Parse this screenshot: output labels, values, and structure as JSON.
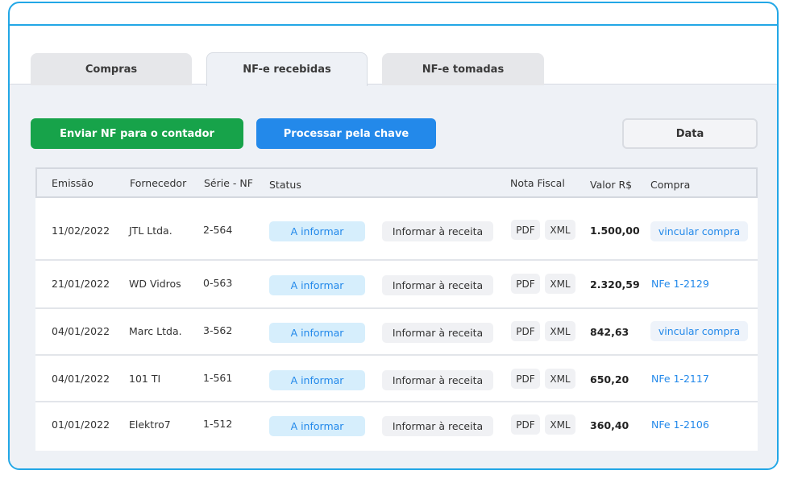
{
  "tabs": [
    "Compras",
    "NF-e recebidas",
    "NF-e tomadas"
  ],
  "active_tab": "NF-e recebidas",
  "actions": {
    "send_label": "Enviar NF para o contador",
    "process_label": "Processar pela chave",
    "date_label": "Data"
  },
  "table": {
    "headers": [
      "Emissão",
      "Fornecedor",
      "Série - NF",
      "Status",
      "Nota Fiscal",
      "Valor R$",
      "Compra"
    ],
    "rows": [
      {
        "emissao": "11/02/2022",
        "fornecedor": "JTL Ltda.",
        "serie": "2-564",
        "status": "A informar",
        "action": "Informar à receita",
        "pdf": "PDF",
        "xml": "XML",
        "valor": "1.500,00",
        "compra": "vincular compra",
        "compra_type": "button"
      },
      {
        "emissao": "21/01/2022",
        "fornecedor": "WD Vidros",
        "serie": "0-563",
        "status": "A informar",
        "action": "Informar à receita",
        "pdf": "PDF",
        "xml": "XML",
        "valor": "2.320,59",
        "compra": "NFe 1-2129",
        "compra_type": "link"
      },
      {
        "emissao": "04/01/2022",
        "fornecedor": "Marc Ltda.",
        "serie": "3-562",
        "status": "A informar",
        "action": "Informar à receita",
        "pdf": "PDF",
        "xml": "XML",
        "valor": "842,63",
        "compra": "vincular compra",
        "compra_type": "button"
      },
      {
        "emissao": "04/01/2022",
        "fornecedor": "101 TI",
        "serie": "1-561",
        "status": "A informar",
        "action": "Informar à receita",
        "pdf": "PDF",
        "xml": "XML",
        "valor": "650,20",
        "compra": "NFe 1-2117",
        "compra_type": "link"
      },
      {
        "emissao": "01/01/2022",
        "fornecedor": "Elektro7",
        "serie": "1-512",
        "status": "A informar",
        "action": "Informar à receita",
        "pdf": "PDF",
        "xml": "XML",
        "valor": "360,40",
        "compra": "NFe 1-2106",
        "compra_type": "link"
      }
    ]
  },
  "colors": {
    "frame_border": "#22a7e6",
    "primary_green": "#17a34a",
    "primary_blue": "#2389ea",
    "status_bg": "#d6eefc"
  }
}
